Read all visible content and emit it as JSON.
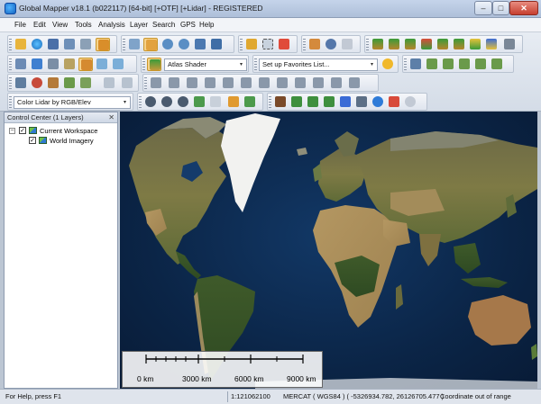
{
  "window": {
    "title": "Global Mapper v18.1 (b022117) [64-bit] [+OTF] [+Lidar] - REGISTERED",
    "minimize": "–",
    "maximize": "□",
    "close": "✕"
  },
  "menu": [
    "File",
    "Edit",
    "View",
    "Tools",
    "Analysis",
    "Layer",
    "Search",
    "GPS",
    "Help"
  ],
  "toolbars": {
    "shader_dropdown": "Atlas Shader",
    "favorites_dropdown": "Set up Favorites List...",
    "lidar_color_dropdown": "Color Lidar by RGB/Elev",
    "dropdown_arrow": "▾"
  },
  "control_center": {
    "title": "Control Center (1 Layers)",
    "close": "✕",
    "workspace_label": "Current Workspace",
    "layer_label": "World Imagery",
    "expander": "−",
    "check": "✓"
  },
  "scale_bar": {
    "labels": [
      "0 km",
      "3000 km",
      "6000 km",
      "9000 km"
    ]
  },
  "status": {
    "help": "For Help, press F1",
    "scale": "1:121062100",
    "projection_info": "MERCAT ( WGS84 ) ( -5326934.782, 26126705.477 )",
    "coord_message": "Coordinate out of range"
  },
  "colors": {
    "ocean": "#0b2547",
    "land": "#7b7344",
    "ice": "#f2f2f0",
    "toolbar_active": "#f6d28a"
  },
  "icons": [
    "open-icon",
    "globe-icon",
    "save-icon",
    "export-icon",
    "config-icon",
    "layers-icon",
    "zoom-icon",
    "pan-icon",
    "zoom-in-icon",
    "zoom-out-icon",
    "back-icon",
    "home-icon",
    "digitize-icon",
    "select-icon",
    "delete-icon",
    "measure-icon",
    "info-icon",
    "search-icon",
    "terrain-icon",
    "shader-icon",
    "star-icon"
  ]
}
